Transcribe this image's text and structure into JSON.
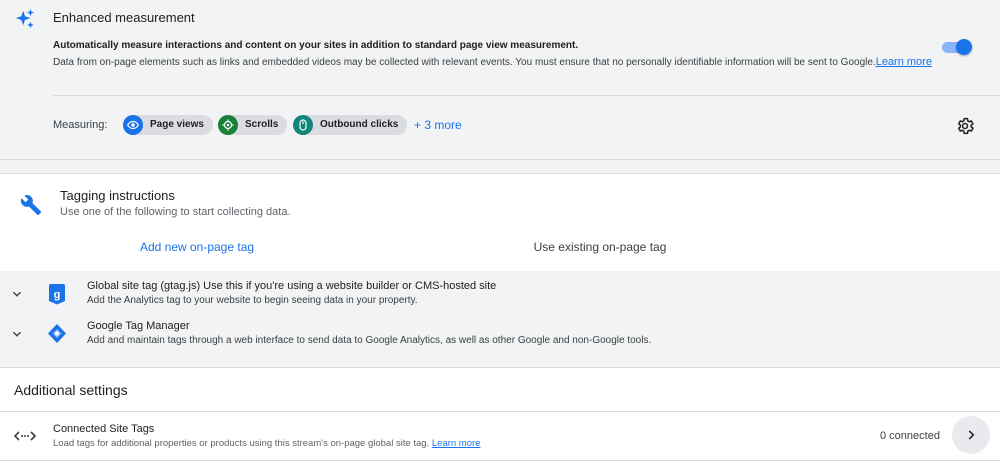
{
  "enhanced": {
    "title": "Enhanced measurement",
    "desc1": "Automatically measure interactions and content on your sites in addition to standard page view measurement.",
    "desc2": "Data from on-page elements such as links and embedded videos may be collected with relevant events. You must ensure that no personally identifiable information will be sent to Google.",
    "learn_more": "Learn more",
    "toggle_on": true,
    "measuring_label": "Measuring:",
    "chips": [
      {
        "label": "Page views",
        "icon": "eye-icon",
        "color": "#1a73e8"
      },
      {
        "label": "Scrolls",
        "icon": "crosshair-icon",
        "color": "#188038"
      },
      {
        "label": "Outbound clicks",
        "icon": "mouse-icon",
        "color": "#12857b"
      }
    ],
    "more": "+ 3 more"
  },
  "tagging": {
    "title": "Tagging instructions",
    "subtitle": "Use one of the following to start collecting data.",
    "tabs": [
      "Add new on-page tag",
      "Use existing on-page tag"
    ],
    "active_tab": 0,
    "options": [
      {
        "title_bold": "Global site tag (gtag.js)",
        "title_rest": " Use this if you're using a website builder or CMS-hosted site",
        "subtitle": "Add the Analytics tag to your website to begin seeing data in your property."
      },
      {
        "title_bold": "Google Tag Manager",
        "title_rest": "",
        "subtitle": "Add and maintain tags through a web interface to send data to Google Analytics, as well as other Google and non-Google tools."
      }
    ]
  },
  "additional": {
    "title": "Additional settings",
    "connected": {
      "title": "Connected Site Tags",
      "subtitle": "Load tags for additional properties or products using this stream's on-page global site tag.",
      "learn_more": "Learn more",
      "count": "0 connected"
    }
  },
  "colors": {
    "accent": "#1a73e8",
    "panel": "#f1f3f4"
  }
}
